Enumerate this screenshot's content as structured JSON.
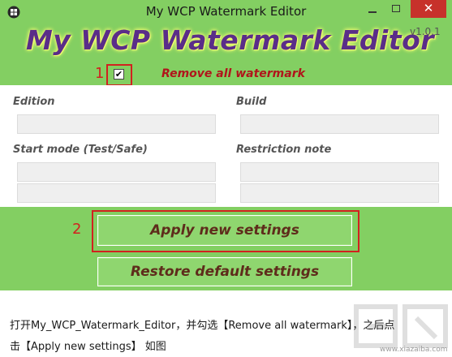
{
  "window": {
    "title": "My WCP Watermark Editor",
    "close_glyph": "✕",
    "icon": "windows-logo-icon"
  },
  "header": {
    "app_title": "My WCP Watermark Editor",
    "version": "v1.0.1",
    "title_color": "#5a2d89",
    "accent_green": "#83cf62"
  },
  "annotations": {
    "step1": "1",
    "step2": "2",
    "highlight_color": "#d2211f"
  },
  "options": {
    "remove_all_label": "Remove all watermark",
    "remove_all_checked": true,
    "check_glyph": "✔"
  },
  "fields": {
    "edition_label": "Edition",
    "edition_value": "",
    "build_label": "Build",
    "build_value": "",
    "start_mode_label": "Start mode (Test/Safe)",
    "start_mode_value_1": "",
    "start_mode_value_2": "",
    "restriction_label": "Restriction note",
    "restriction_value_1": "",
    "restriction_value_2": ""
  },
  "actions": {
    "apply_label": "Apply new settings",
    "restore_label": "Restore default settings"
  },
  "caption": {
    "line1": "打开My_WCP_Watermark_Editor，并勾选【Remove all watermark】，之后点",
    "line2": "击【Apply new settings】 如图"
  },
  "site_watermark": {
    "text": "www.xiazaiba.com"
  }
}
